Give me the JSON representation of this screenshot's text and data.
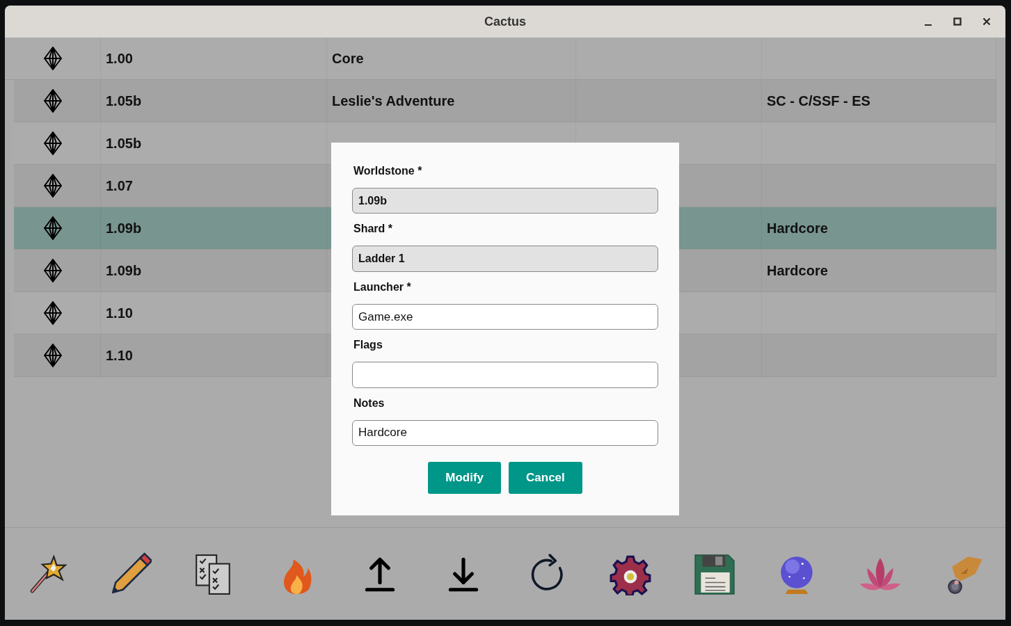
{
  "window": {
    "title": "Cactus"
  },
  "table": {
    "rows": [
      {
        "version": "1.00",
        "name": "Core",
        "selected": false
      },
      {
        "version": "1.05b",
        "name": "Leslie's Adventure",
        "notes": "SC - C/SSF - ES",
        "selected": false
      },
      {
        "version": "1.05b",
        "selected": false
      },
      {
        "version": "1.07",
        "selected": false
      },
      {
        "version": "1.09b",
        "notes": "Hardcore",
        "selected": true
      },
      {
        "version": "1.09b",
        "notes": "Hardcore",
        "selected": false
      },
      {
        "version": "1.10",
        "selected": false
      },
      {
        "version": "1.10",
        "selected": false
      }
    ]
  },
  "dialog": {
    "fields": [
      {
        "label": "Worldstone *",
        "value": "1.09b",
        "disabled": true
      },
      {
        "label": "Shard *",
        "value": "Ladder 1",
        "disabled": true
      },
      {
        "label": "Launcher *",
        "value": "Game.exe",
        "disabled": false
      },
      {
        "label": "Flags",
        "disabled": false
      },
      {
        "label": "Notes",
        "value": "Hardcore",
        "disabled": false
      }
    ],
    "buttons": [
      "Modify",
      "Cancel"
    ]
  }
}
